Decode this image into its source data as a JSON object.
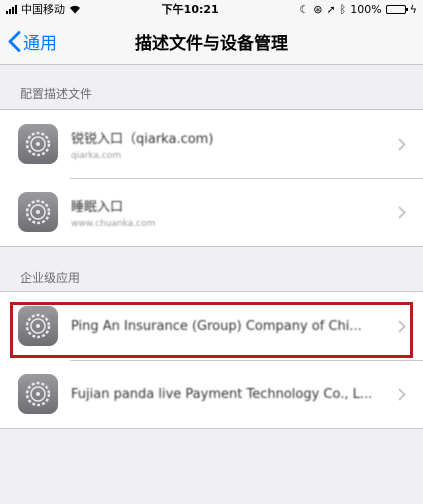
{
  "status_bar": {
    "carrier": "中国移动",
    "time": "下午10:21",
    "battery": "100%"
  },
  "nav": {
    "back_label": "通用",
    "title": "描述文件与设备管理"
  },
  "sections": [
    {
      "header": "配置描述文件",
      "items": [
        {
          "title": "锐锐入口（qiarka.com)",
          "subtitle": "qiarka.com"
        },
        {
          "title": "睡眠入口",
          "subtitle": "www.chuanka.com"
        }
      ]
    },
    {
      "header": "企业级应用",
      "items": [
        {
          "title": "Ping An Insurance (Group) Company of Chi...",
          "subtitle": ""
        },
        {
          "title": "Fujian panda live Payment Technology Co., L...",
          "subtitle": ""
        }
      ]
    }
  ],
  "colors": {
    "accent": "#007aff",
    "highlight_border": "#b71c1c",
    "icon": "settings-gear-icon"
  }
}
